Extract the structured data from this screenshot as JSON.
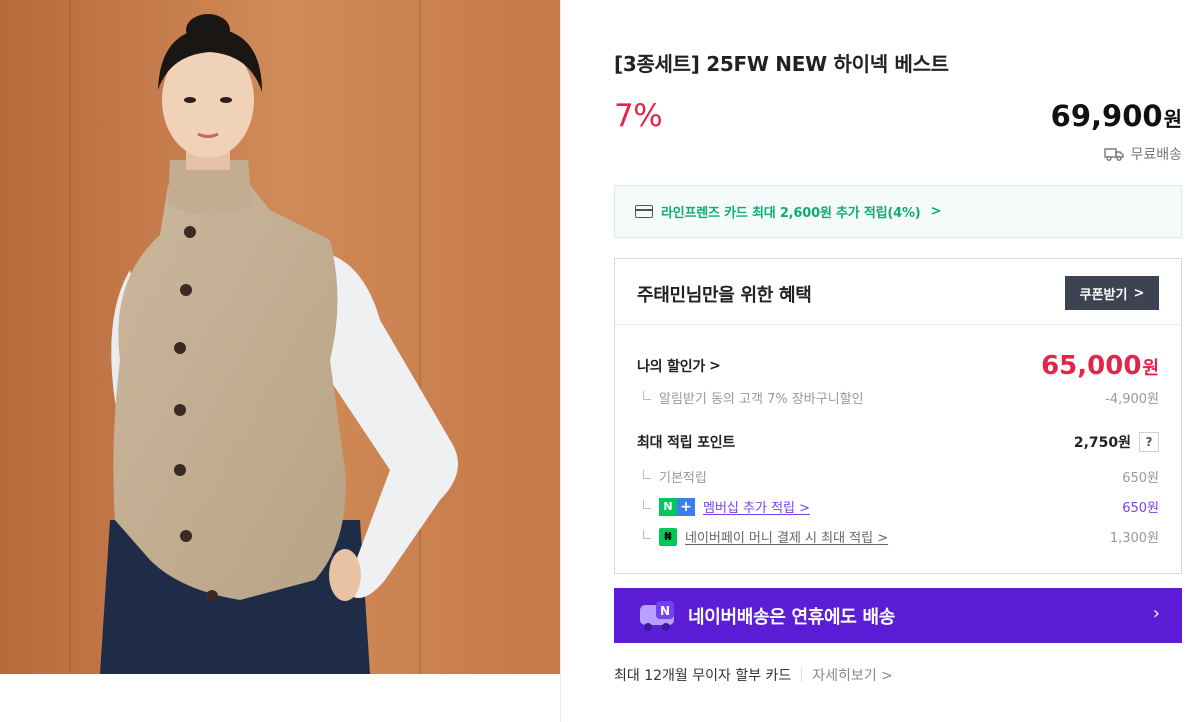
{
  "product": {
    "title": "[3종세트] 25FW NEW 하이넥 베스트",
    "discount": "7%",
    "price": "69,900",
    "price_unit": "원",
    "shipping": "무료배송"
  },
  "card_banner": {
    "text": "라인프렌즈 카드 최대 2,600원 추가 적립(4%)",
    "chevron": ">"
  },
  "benefits": {
    "title": "주태민님만을 위한 혜택",
    "coupon_button": "쿠폰받기",
    "coupon_chevron": ">",
    "my_price_label": "나의 할인가",
    "my_price_chevron": ">",
    "my_price": "65,000",
    "my_price_unit": "원",
    "my_price_detail_label": "알림받기 동의 고객 7% 장바구니할인",
    "my_price_detail_value": "-4,900원",
    "points_label": "최대 적립 포인트",
    "points_value": "2,750원",
    "points_help": "?",
    "basic_points_label": "기본적립",
    "basic_points_value": "650원",
    "membership_badge_n": "N",
    "membership_badge_plus": "+",
    "membership_label": "멤버십 추가 적립",
    "membership_chevron": ">",
    "membership_value": "650원",
    "pay_badge": "₦",
    "pay_label": "네이버페이 머니 결제 시 최대 적립",
    "pay_chevron": ">",
    "pay_value": "1,300원"
  },
  "delivery": {
    "text": "네이버배송은 연휴에도 배송",
    "icon_badge": "N",
    "chevron": "›"
  },
  "installment": {
    "text": "최대 12개월 무이자 할부 카드",
    "link": "자세히보기",
    "chevron": ">"
  },
  "colors": {
    "accent_red": "#e1264a",
    "naver_green": "#03c75a",
    "delivery_purple": "#5b1ed6",
    "button_dark": "#3d4350"
  }
}
